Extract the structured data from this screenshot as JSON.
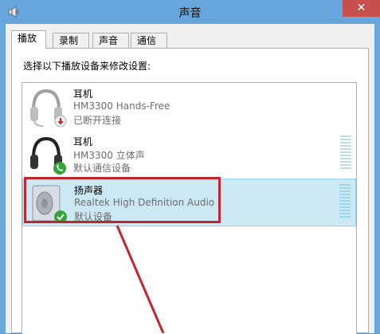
{
  "window": {
    "title": "声音",
    "close_glyph": "✕"
  },
  "tabs": [
    {
      "label": "播放",
      "active": true
    },
    {
      "label": "录制",
      "active": false
    },
    {
      "label": "声音",
      "active": false
    },
    {
      "label": "通信",
      "active": false
    }
  ],
  "instruction": "选择以下播放设备来修改设置:",
  "devices": [
    {
      "name": "耳机",
      "description": "HM3300 Hands-Free",
      "status": "已断开连接",
      "icon": "headphones-icon",
      "badge": "disconnected-badge-icon",
      "selected": false
    },
    {
      "name": "耳机",
      "description": "HM3300 立体声",
      "status": "默认通信设备",
      "icon": "headphones-icon",
      "badge": "phone-badge-icon",
      "selected": false
    },
    {
      "name": "扬声器",
      "description": "Realtek High Definition Audio",
      "status": "默认设备",
      "icon": "speaker-icon",
      "badge": "checkmark-badge-icon",
      "selected": true
    }
  ],
  "colors": {
    "accent_highlight": "#c0272d",
    "selection": "#cce8f3",
    "title_bar": "#66a6dc"
  }
}
